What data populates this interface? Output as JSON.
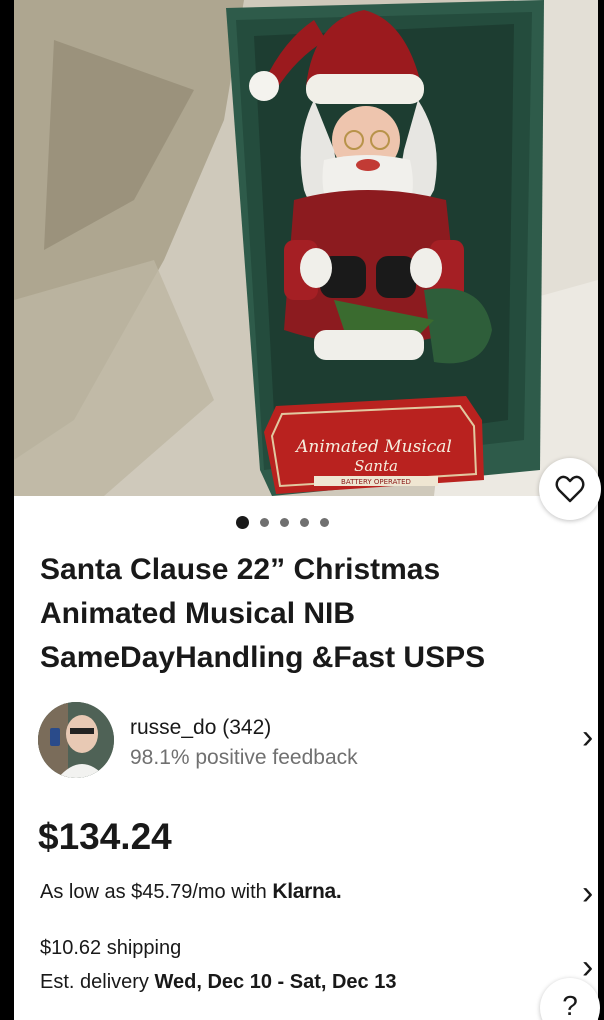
{
  "gallery": {
    "box_label_line1": "Animated Musical",
    "box_label_line2": "Santa",
    "box_label_small": "BATTERY OPERATED",
    "image_count": 5,
    "active_index": 1
  },
  "listing": {
    "title": "Santa Clause 22” Christmas Animated Musical NIB SameDayHandling &Fast USPS",
    "price": "$134.24"
  },
  "seller": {
    "name_line": "russe_do (342)",
    "feedback": "98.1% positive feedback"
  },
  "financing": {
    "text": "As low as $45.79/mo with",
    "provider": "Klarna."
  },
  "shipping": {
    "cost": "$10.62 shipping",
    "delivery_prefix": "Est. delivery",
    "delivery_range": "Wed, Dec 10 - Sat, Dec 13"
  },
  "icons": {
    "save": "heart-icon",
    "seller_chevron": "chevron-right-icon",
    "help": "question-icon"
  },
  "help_label": "?",
  "chevron_glyph": "›"
}
